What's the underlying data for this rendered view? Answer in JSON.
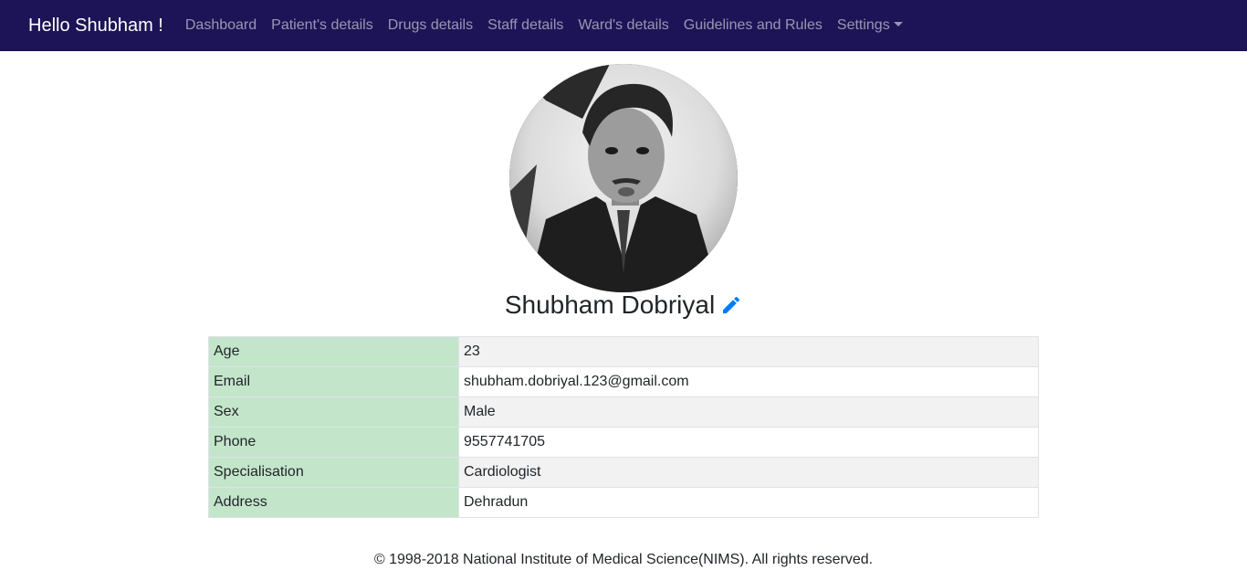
{
  "navbar": {
    "brand": "Hello Shubham !",
    "links": [
      "Dashboard",
      "Patient's details",
      "Drugs details",
      "Staff details",
      "Ward's details",
      "Guidelines and Rules"
    ],
    "settings_label": "Settings",
    "background": "#1c1456"
  },
  "profile": {
    "name": "Shubham Dobriyal",
    "edit_icon": "pencil-icon",
    "edit_icon_color": "#007bff"
  },
  "details": {
    "rows": [
      {
        "label": "Age",
        "value": "23"
      },
      {
        "label": "Email",
        "value": "shubham.dobriyal.123@gmail.com"
      },
      {
        "label": "Sex",
        "value": "Male"
      },
      {
        "label": "Phone",
        "value": "9557741705"
      },
      {
        "label": "Specialisation",
        "value": "Cardiologist"
      },
      {
        "label": "Address",
        "value": "Dehradun"
      }
    ],
    "label_background": "#c3e6cb"
  },
  "footer": {
    "text": "© 1998-2018 National Institute of Medical Science(NIMS). All rights reserved."
  }
}
